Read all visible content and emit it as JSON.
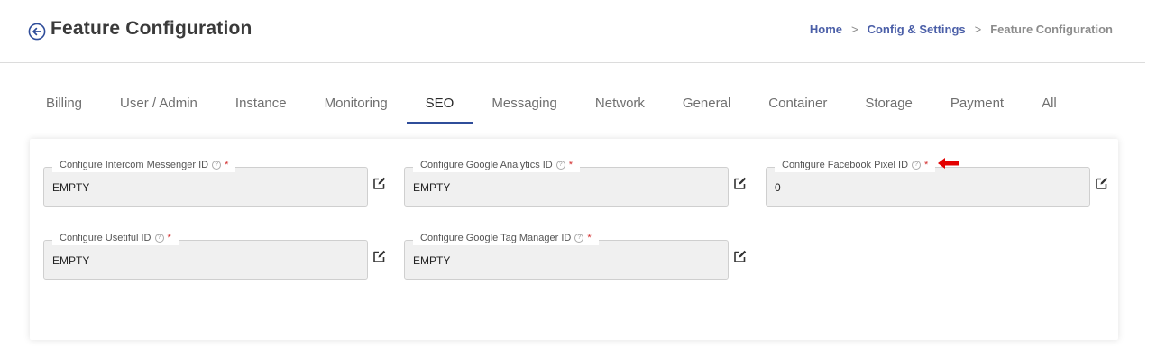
{
  "header": {
    "title": "Feature Configuration",
    "back_icon": "arrow-left-circle-icon"
  },
  "breadcrumb": {
    "items": [
      "Home",
      "Config & Settings"
    ],
    "separator": ">",
    "current": "Feature Configuration"
  },
  "tabs": [
    {
      "label": "Billing",
      "active": false
    },
    {
      "label": "User / Admin",
      "active": false
    },
    {
      "label": "Instance",
      "active": false
    },
    {
      "label": "Monitoring",
      "active": false
    },
    {
      "label": "SEO",
      "active": true
    },
    {
      "label": "Messaging",
      "active": false
    },
    {
      "label": "Network",
      "active": false
    },
    {
      "label": "General",
      "active": false
    },
    {
      "label": "Container",
      "active": false
    },
    {
      "label": "Storage",
      "active": false
    },
    {
      "label": "Payment",
      "active": false
    },
    {
      "label": "All",
      "active": false
    }
  ],
  "fields": [
    {
      "label": "Configure Intercom Messenger ID",
      "help": "?",
      "required": "*",
      "value": "EMPTY"
    },
    {
      "label": "Configure Google Analytics ID",
      "help": "?",
      "required": "*",
      "value": "EMPTY"
    },
    {
      "label": "Configure Facebook Pixel ID",
      "help": "?",
      "required": "*",
      "value": "0"
    },
    {
      "label": "Configure Usetiful ID",
      "help": "?",
      "required": "*",
      "value": "EMPTY"
    },
    {
      "label": "Configure Google Tag Manager ID",
      "help": "?",
      "required": "*",
      "value": "EMPTY"
    }
  ],
  "colors": {
    "accent": "#2f4d9a",
    "link": "#4b5fa8",
    "required": "#d32f2f",
    "annotation_arrow": "#e30000"
  }
}
